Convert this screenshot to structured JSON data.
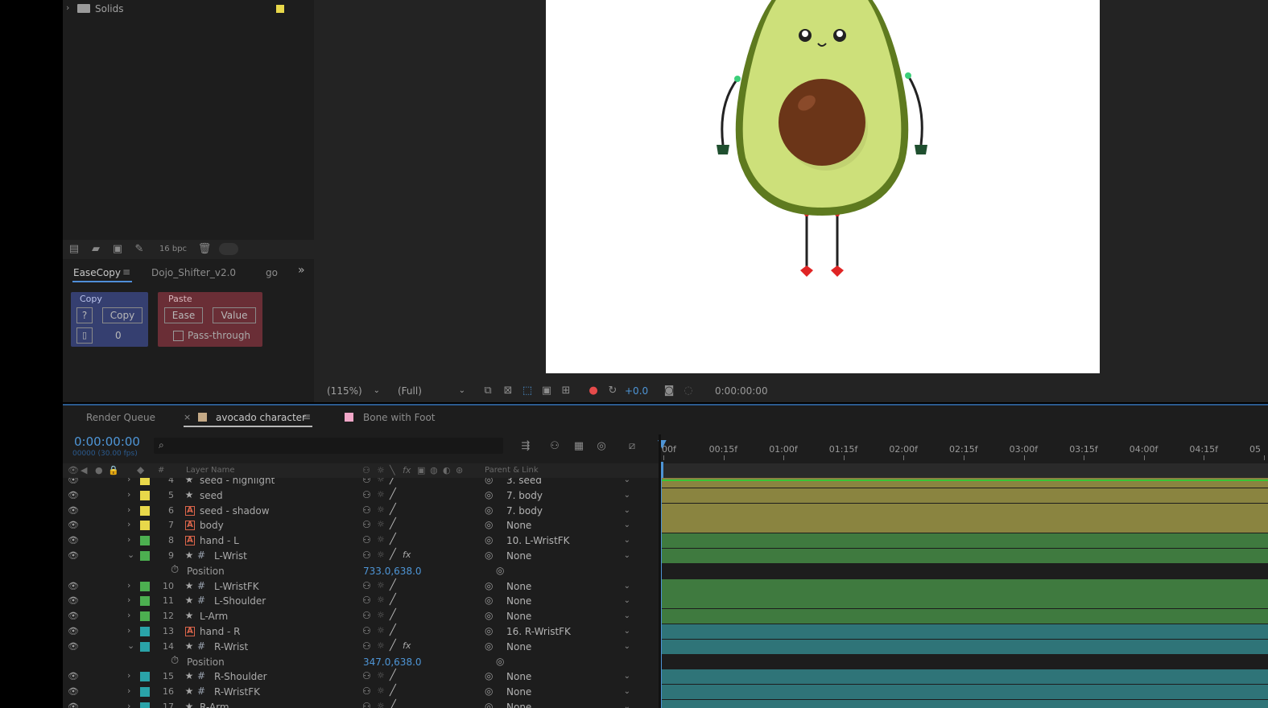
{
  "project": {
    "folder_name": "Solids",
    "folder_color": "#e8d84a",
    "footer": {
      "bpc_label": "16 bpc"
    }
  },
  "easecopy": {
    "tabs": [
      {
        "label": "EaseCopy",
        "active": true
      },
      {
        "label": "Dojo_Shifter_v2.0",
        "active": false
      },
      {
        "label": "go",
        "active": false
      }
    ],
    "overflow_icon": "double-chevron-right-icon",
    "copy_group": {
      "label": "Copy",
      "help_label": "?",
      "copy_label": "Copy",
      "counter_value": "0"
    },
    "paste_group": {
      "label": "Paste",
      "ease_label": "Ease",
      "value_label": "Value",
      "passthrough_label": "Pass-through",
      "passthrough_checked": false
    }
  },
  "viewer": {
    "zoom": "(115%)",
    "resolution": "(Full)",
    "exposure": "+0.0",
    "timecode": "0:00:00:00"
  },
  "timeline": {
    "tabs": {
      "render_queue": "Render Queue",
      "comp": "avocado character",
      "comp_color": "#c4a986",
      "other_comp": "Bone with Foot",
      "other_color": "#f1a7c8"
    },
    "current_time": "0:00:00:00",
    "frame_info": "00000 (30.00 fps)",
    "search_placeholder": "",
    "headers": {
      "num": "#",
      "layer_name": "Layer Name",
      "parent_link": "Parent & Link"
    },
    "ruler_labels": [
      "00f",
      "00:15f",
      "01:00f",
      "01:15f",
      "02:00f",
      "02:15f",
      "03:00f",
      "03:15f",
      "04:00f",
      "04:15f",
      "05"
    ],
    "partial_top": {
      "num": "4",
      "name": "seed - highlight",
      "parent": "3. seed",
      "color": "#e8d84a"
    },
    "layers": [
      {
        "num": "5",
        "name": "seed",
        "type": "shape",
        "null": false,
        "color": "#e8d84a",
        "parent": "7. body",
        "expanded": false,
        "fx": false,
        "bar_color": "#8a8440"
      },
      {
        "num": "6",
        "name": "seed - shadow",
        "type": "text",
        "null": false,
        "color": "#e8d84a",
        "parent": "7. body",
        "expanded": false,
        "fx": false,
        "bar_color": "#8a8440"
      },
      {
        "num": "7",
        "name": "body",
        "type": "text",
        "null": false,
        "color": "#e8d84a",
        "parent": "None",
        "expanded": false,
        "fx": false,
        "bar_color": "#8a8440"
      },
      {
        "num": "8",
        "name": "hand - L",
        "type": "text",
        "null": false,
        "color": "#4caf50",
        "parent": "10. L-WristFK",
        "expanded": false,
        "fx": false,
        "bar_color": "#3f7a3f"
      },
      {
        "num": "9",
        "name": "L-Wrist",
        "type": "shape",
        "null": true,
        "color": "#4caf50",
        "parent": "None",
        "expanded": true,
        "fx": true,
        "bar_color": "#3f7a3f",
        "property": {
          "name": "Position",
          "value": "733.0,638.0"
        }
      },
      {
        "num": "10",
        "name": "L-WristFK",
        "type": "shape",
        "null": true,
        "color": "#4caf50",
        "parent": "None",
        "expanded": false,
        "fx": false,
        "bar_color": "#3f7a3f"
      },
      {
        "num": "11",
        "name": "L-Shoulder",
        "type": "shape",
        "null": true,
        "color": "#4caf50",
        "parent": "None",
        "expanded": false,
        "fx": false,
        "bar_color": "#3f7a3f"
      },
      {
        "num": "12",
        "name": "L-Arm",
        "type": "shape",
        "null": false,
        "color": "#4caf50",
        "parent": "None",
        "expanded": false,
        "fx": false,
        "bar_color": "#3f7a3f"
      },
      {
        "num": "13",
        "name": "hand - R",
        "type": "text",
        "null": false,
        "color": "#2aa3a8",
        "parent": "16. R-WristFK",
        "expanded": false,
        "fx": false,
        "bar_color": "#2f7478"
      },
      {
        "num": "14",
        "name": "R-Wrist",
        "type": "shape",
        "null": true,
        "color": "#2aa3a8",
        "parent": "None",
        "expanded": true,
        "fx": true,
        "bar_color": "#2f7478",
        "property": {
          "name": "Position",
          "value": "347.0,638.0"
        }
      },
      {
        "num": "15",
        "name": "R-Shoulder",
        "type": "shape",
        "null": true,
        "color": "#2aa3a8",
        "parent": "None",
        "expanded": false,
        "fx": false,
        "bar_color": "#2f7478"
      },
      {
        "num": "16",
        "name": "R-WristFK",
        "type": "shape",
        "null": true,
        "color": "#2aa3a8",
        "parent": "None",
        "expanded": false,
        "fx": false,
        "bar_color": "#2f7478"
      }
    ],
    "partial_bottom": {
      "num": "17",
      "name": "R-Arm",
      "parent": "None",
      "color": "#2aa3a8"
    }
  }
}
